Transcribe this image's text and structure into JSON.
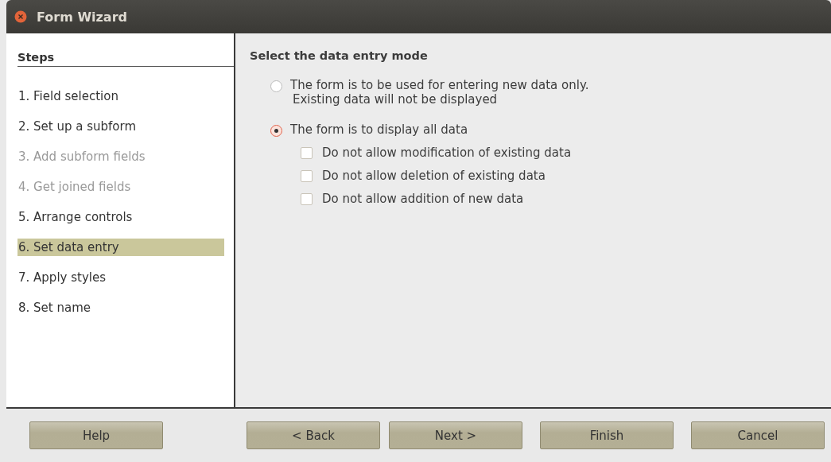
{
  "window": {
    "title": "Form Wizard"
  },
  "sidebar": {
    "heading": "Steps",
    "items": [
      {
        "label": "1. Field selection",
        "disabled": false,
        "selected": false
      },
      {
        "label": "2. Set up a subform",
        "disabled": false,
        "selected": false
      },
      {
        "label": "3. Add subform fields",
        "disabled": true,
        "selected": false
      },
      {
        "label": "4. Get joined fields",
        "disabled": true,
        "selected": false
      },
      {
        "label": "5. Arrange controls",
        "disabled": false,
        "selected": false
      },
      {
        "label": "6. Set data entry",
        "disabled": false,
        "selected": true
      },
      {
        "label": "7. Apply styles",
        "disabled": false,
        "selected": false
      },
      {
        "label": "8. Set name",
        "disabled": false,
        "selected": false
      }
    ]
  },
  "content": {
    "heading": "Select the data entry mode",
    "options": [
      {
        "label": "The form is to be used for entering new data only.",
        "note": "Existing data will not be displayed",
        "selected": false
      },
      {
        "label": "The form is to display all data",
        "selected": true,
        "checkboxes": [
          {
            "label": "Do not allow modification of existing data",
            "checked": false
          },
          {
            "label": "Do not allow deletion of existing data",
            "checked": false
          },
          {
            "label": "Do not allow addition of new data",
            "checked": false
          }
        ]
      }
    ]
  },
  "buttons": [
    {
      "label": "Help",
      "kind": "help"
    },
    {
      "label": "< Back",
      "kind": "nav"
    },
    {
      "label": "Next >",
      "kind": "nav"
    },
    {
      "label": "Finish",
      "kind": "finish"
    },
    {
      "label": "Cancel",
      "kind": "cancel"
    }
  ]
}
